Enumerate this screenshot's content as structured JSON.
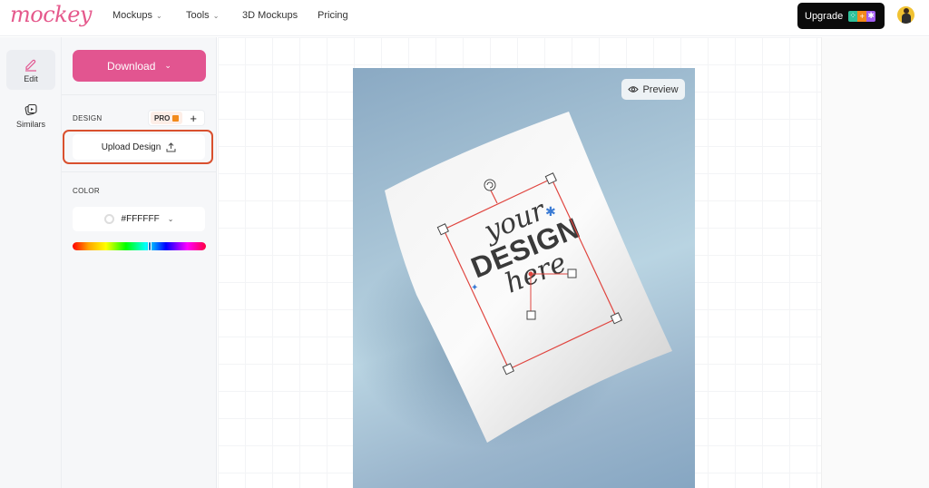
{
  "brand": {
    "logo_text": "mockey",
    "accent": "#e25590"
  },
  "nav": {
    "items": [
      {
        "label": "Mockups",
        "has_dropdown": true
      },
      {
        "label": "Tools",
        "has_dropdown": true
      },
      {
        "label": "3D Mockups",
        "has_dropdown": false
      },
      {
        "label": "Pricing",
        "has_dropdown": false
      }
    ],
    "chevron": "⌄",
    "upgrade_label": "Upgrade",
    "upgrade_badges": [
      "⁘",
      "+",
      "✱"
    ]
  },
  "rail": {
    "items": [
      {
        "label": "Edit",
        "icon": "pencil-icon",
        "active": true
      },
      {
        "label": "Similars",
        "icon": "similars-icon",
        "active": false
      }
    ]
  },
  "panel": {
    "download_label": "Download",
    "design_section_label": "DESIGN",
    "pro_label": "PRO",
    "plus_label": "+",
    "upload_label": "Upload Design",
    "upload_icon": "⇧",
    "color_section_label": "COLOR",
    "color_value": "#FFFFFF",
    "hue_position": 0.58,
    "hue_thumb_color": "#1f6fb7"
  },
  "canvas": {
    "preview_label": "Preview",
    "design_placeholder": {
      "line1": "your",
      "line2": "DESIGN",
      "line3": "here"
    },
    "selection_color": "#e0453f",
    "background_color": "#a8c4d6"
  }
}
